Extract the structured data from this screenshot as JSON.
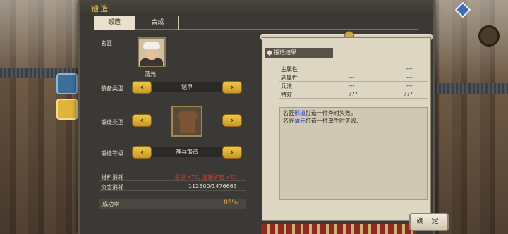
{
  "window": {
    "title": "锻造"
  },
  "tabs": [
    {
      "label": "锻造"
    },
    {
      "label": "合成"
    }
  ],
  "craftsman": {
    "label": "名匠",
    "name": "蒲元"
  },
  "equip_type": {
    "label": "装备类型",
    "value": "铠甲"
  },
  "forge_type": {
    "label": "锻造类型",
    "icon": "armor-icon"
  },
  "forge_level": {
    "label": "锻造等级",
    "value": "神兵锻造"
  },
  "costs": {
    "material_label": "材料消耗",
    "material_value": "金银 X70, 流银矿石 x40",
    "money_label": "资金消耗",
    "money_value": "112500/1476663"
  },
  "success": {
    "label": "成功率",
    "value": "85%"
  },
  "result": {
    "title": "锻造结果",
    "rows": [
      {
        "name": "主属性",
        "col1": "",
        "col2": "---"
      },
      {
        "name": "副属性",
        "col1": "---",
        "col2": "---"
      },
      {
        "name": "兵法",
        "col1": "---",
        "col2": "---"
      },
      {
        "name": "特效",
        "col1": "???",
        "col2": "???"
      }
    ],
    "log": [
      {
        "pre": "名匠",
        "name": "邢道",
        "post": "打造一件斧时失败。"
      },
      {
        "pre": "名匠",
        "name": "蒲元",
        "post": "打造一件单手时失败."
      }
    ]
  },
  "confirm_label": "确 定",
  "colors": {
    "accent": "#e6c24a",
    "highlight": "#2c48c6",
    "warning": "#c9443a",
    "success": "#e6b23a"
  }
}
